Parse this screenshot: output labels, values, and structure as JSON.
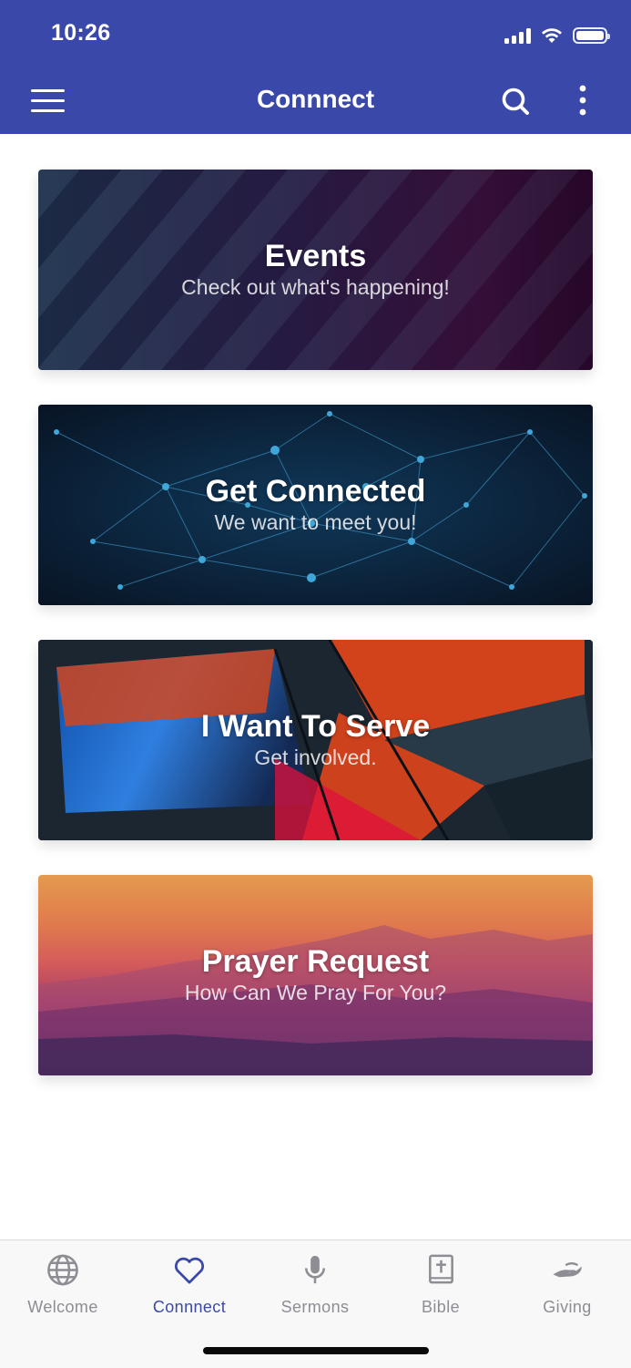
{
  "status_bar": {
    "time": "10:26"
  },
  "header": {
    "title": "Connnect",
    "icons": {
      "menu": "hamburger-menu-icon",
      "search": "search-icon",
      "more": "more-vert-icon"
    }
  },
  "cards": [
    {
      "title": "Events",
      "subtitle": "Check out what's happening!"
    },
    {
      "title": "Get Connected",
      "subtitle": "We want to meet you!"
    },
    {
      "title": "I Want To Serve",
      "subtitle": "Get involved."
    },
    {
      "title": "Prayer Request",
      "subtitle": "How Can We Pray For You?"
    }
  ],
  "bottom_nav": {
    "active": "Connnect",
    "items": [
      {
        "label": "Welcome",
        "icon": "globe-icon"
      },
      {
        "label": "Connnect",
        "icon": "heart-icon"
      },
      {
        "label": "Sermons",
        "icon": "microphone-icon"
      },
      {
        "label": "Bible",
        "icon": "bible-icon"
      },
      {
        "label": "Giving",
        "icon": "giving-hand-icon"
      }
    ]
  },
  "colors": {
    "primary": "#3a48aa",
    "inactive": "#8d8d93",
    "nav_background": "#f8f8f9"
  }
}
